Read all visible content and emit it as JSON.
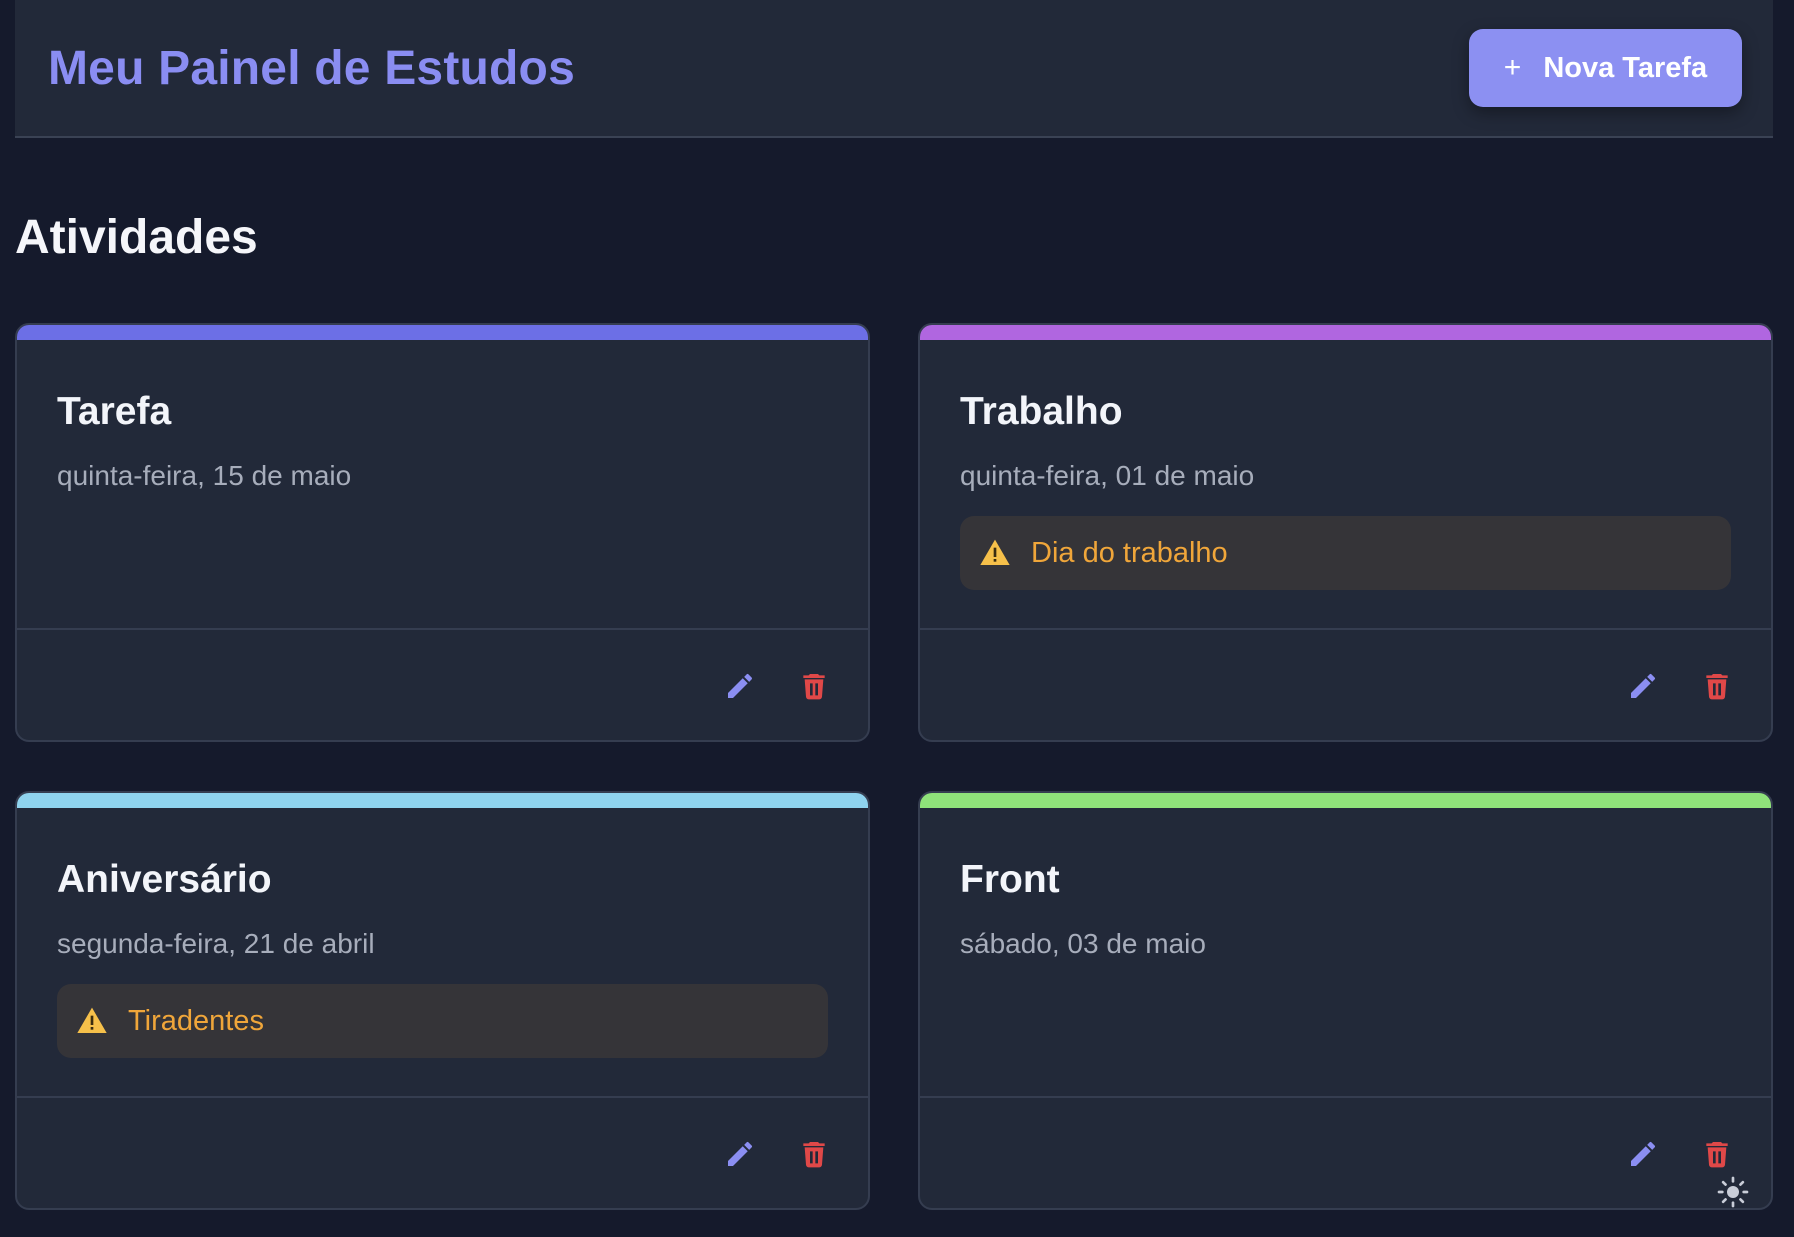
{
  "header": {
    "title": "Meu Painel de Estudos",
    "new_task_icon": "+",
    "new_task_label": "Nova Tarefa"
  },
  "section": {
    "title": "Atividades"
  },
  "cards": [
    {
      "title": "Tarefa",
      "date": "quinta-feira, 15 de maio",
      "accent": "#6c6fe6",
      "holiday": null
    },
    {
      "title": "Trabalho",
      "date": "quinta-feira, 01 de maio",
      "accent": "#b066e0",
      "holiday": "Dia do trabalho"
    },
    {
      "title": "Aniversário",
      "date": "segunda-feira, 21 de abril",
      "accent": "#8fd3ee",
      "holiday": "Tiradentes"
    },
    {
      "title": "Front",
      "date": "sábado, 03 de maio",
      "accent": "#8fe27a",
      "holiday": null
    }
  ],
  "colors": {
    "background": "#151a2c",
    "panel": "#222939",
    "primary": "#8c90f2",
    "warning": "#f0a63a",
    "danger": "#e04848"
  },
  "icons": {
    "edit": "pencil-icon",
    "delete": "trash-icon",
    "warning": "warning-icon",
    "theme": "sun-icon"
  }
}
